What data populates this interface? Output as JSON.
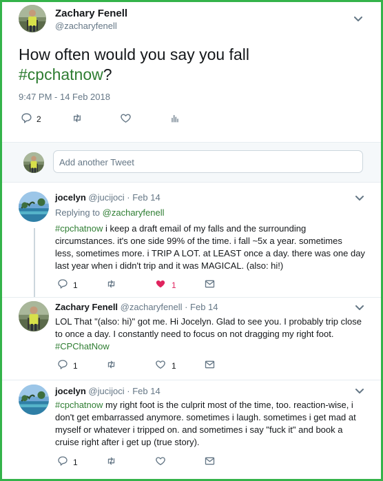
{
  "main_tweet": {
    "name": "Zachary Fenell",
    "handle": "@zacharyfenell",
    "text_prefix": "How often would you say you fall",
    "hashtag": "#cpchatnow",
    "text_suffix": "?",
    "timestamp": "9:47 PM - 14 Feb 2018",
    "reply_count": "2"
  },
  "reply_box": {
    "placeholder": "Add another Tweet"
  },
  "replies": [
    {
      "name": "jocelyn",
      "handle": "@jucijoci",
      "date": "· Feb 14",
      "replying_to_label": "Replying to",
      "replying_to_handle": "@zacharyfenell",
      "hashtag": "#cpchatnow",
      "lines": [
        " i keep a draft email of my falls and the surrounding",
        "circumstances. it's one side 99% of the time. i fall ~5x a year. sometimes",
        "less, sometimes more. i TRIP A LOT. at LEAST once a day. there was one day",
        "last year when i didn't trip and it was MAGICAL. (also: hi!)"
      ],
      "reply_count": "1",
      "like_count": "1"
    },
    {
      "name": "Zachary Fenell",
      "handle": "@zacharyfenell",
      "date": "· Feb 14",
      "lines": [
        "LOL That \"(also: hi)\" got me. Hi Jocelyn. Glad to see you. I probably trip close",
        "to once a day. I constantly need to focus on not dragging my right foot."
      ],
      "hashtag": "#CPChatNow",
      "reply_count": "1",
      "like_count": "1"
    },
    {
      "name": "jocelyn",
      "handle": "@jucijoci",
      "date": "· Feb 14",
      "hashtag": "#cpchatnow",
      "lines": [
        " my right foot is the culprit most of the time, too. reaction-wise, i",
        "don't get embarrassed anymore. sometimes i laugh. sometimes i get mad at",
        "myself or whatever i tripped on. and sometimes i say \"fuck it\" and book a",
        "cruise right after i get up (true story)."
      ],
      "reply_count": "1"
    }
  ],
  "colors": {
    "frame": "#34b34a",
    "hashtag": "#2e7d32",
    "liked": "#e0245e"
  }
}
